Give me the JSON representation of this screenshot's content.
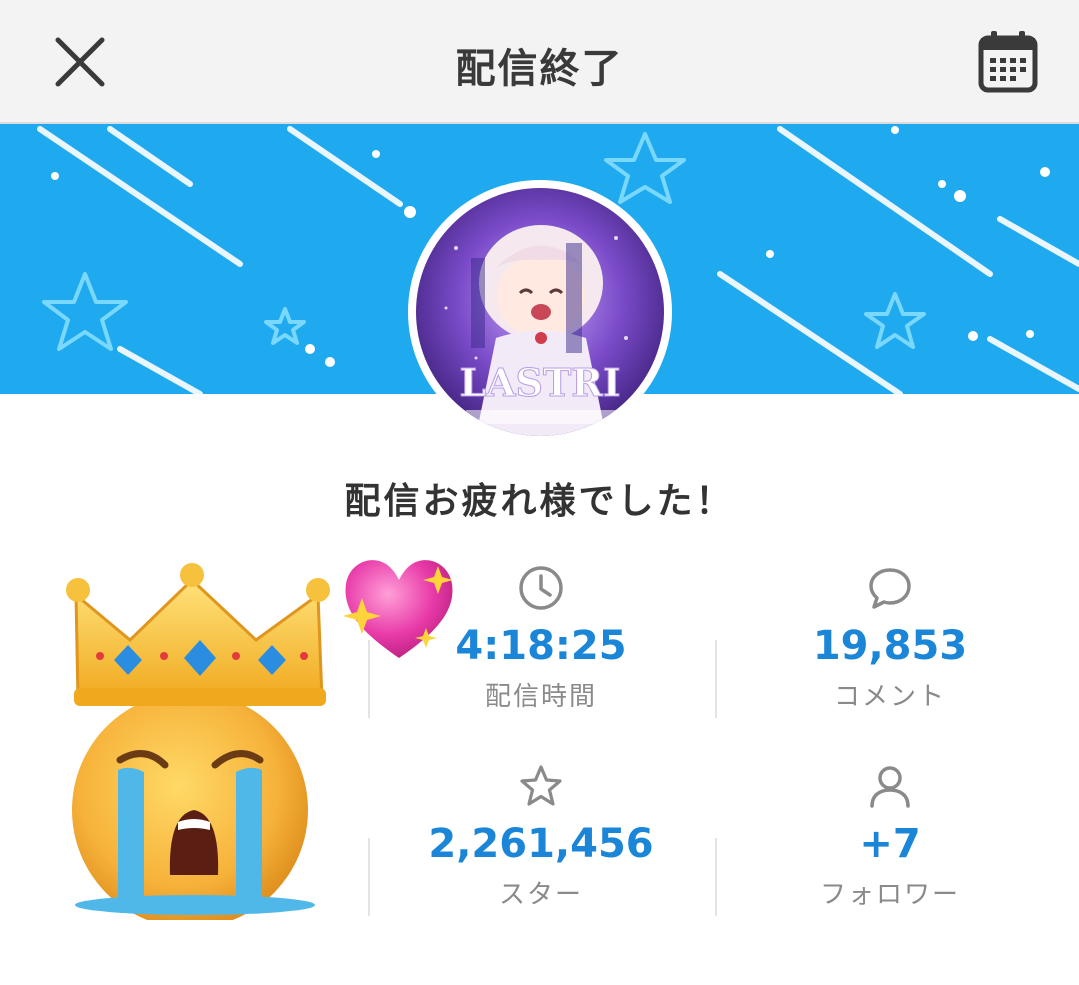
{
  "header": {
    "title": "配信終了"
  },
  "message": "配信お疲れ様でした！",
  "stats": [
    {
      "value": "4:18:25",
      "label": "配信時間",
      "icon": "clock-icon"
    },
    {
      "value": "19,853",
      "label": "コメント",
      "icon": "comment-bubble-icon"
    },
    {
      "value": "2,261,456",
      "label": "スター",
      "icon": "star-icon"
    },
    {
      "value": "+7",
      "label": "フォロワー",
      "icon": "person-icon"
    }
  ],
  "colors": {
    "banner": "#1faaf0",
    "value_text": "#1b86d8",
    "label_text": "#8a8a8a",
    "header_bg": "#f3f3f3"
  },
  "avatar": {
    "icon": "stream-thumbnail-avatar",
    "logo_text": "LASTRI"
  }
}
